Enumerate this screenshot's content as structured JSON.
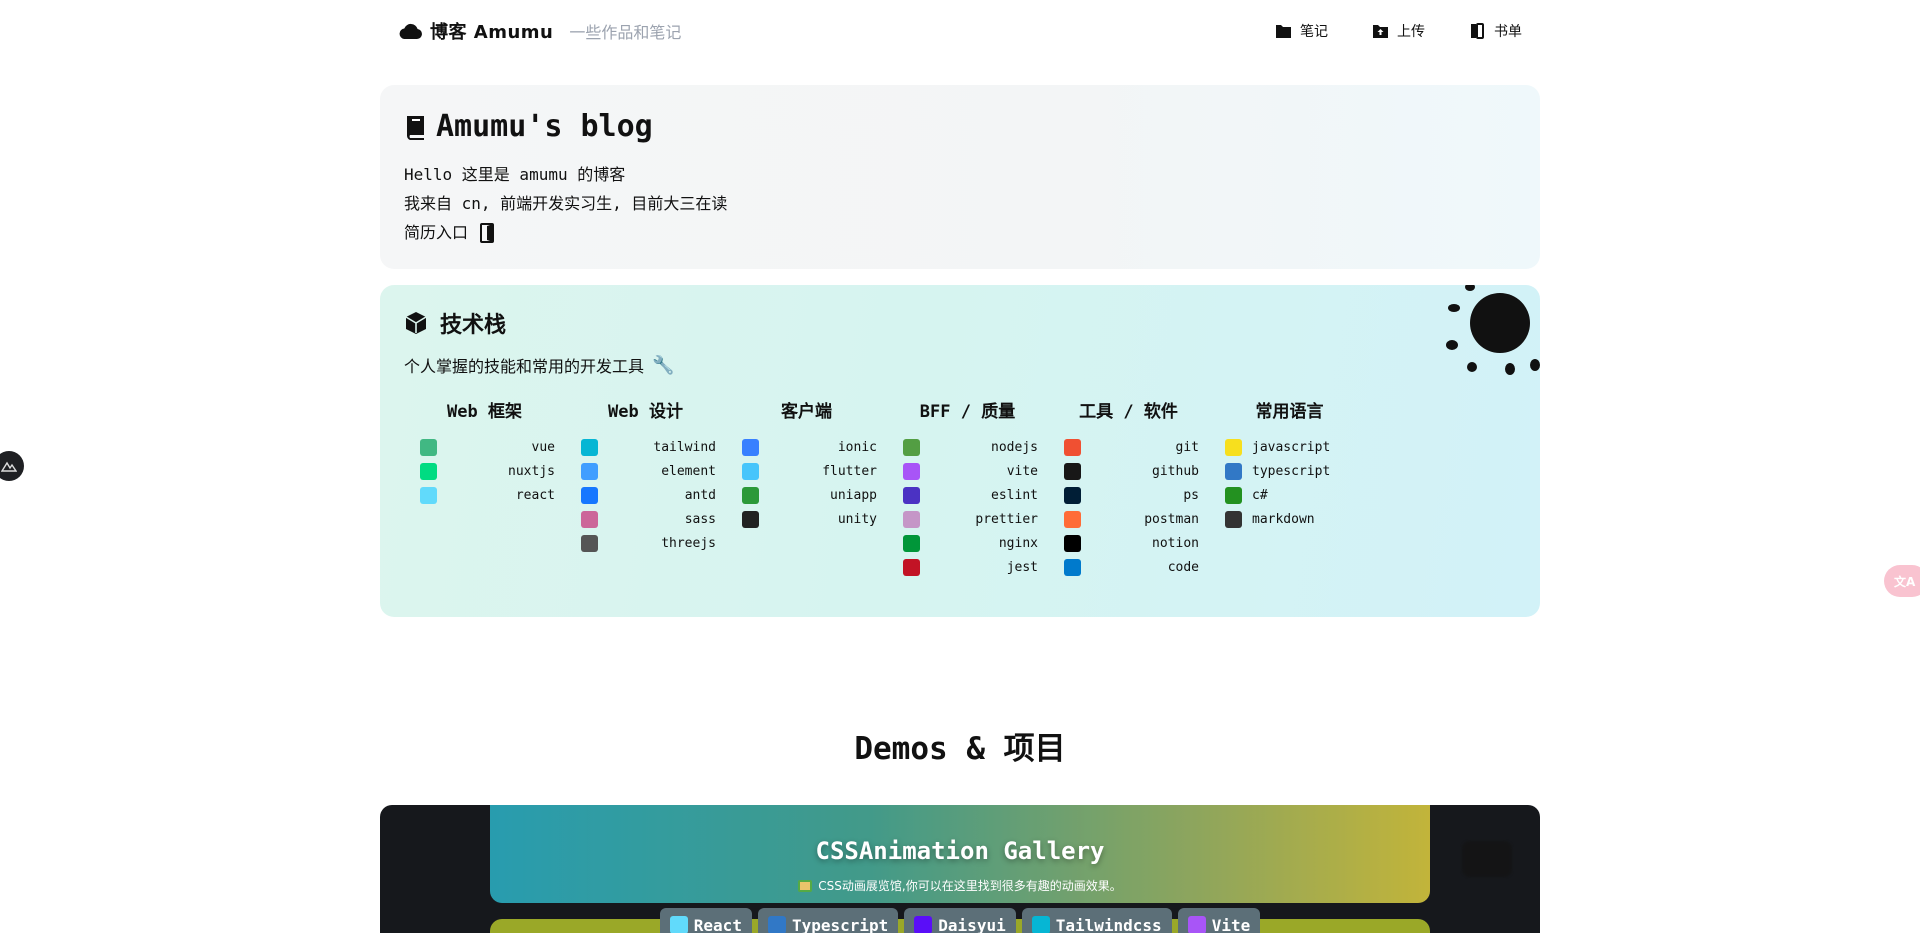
{
  "header": {
    "brand_title": "博客 Amumu",
    "brand_subtitle": "一些作品和笔记",
    "nav": [
      {
        "label": "笔记",
        "icon": "folder-icon"
      },
      {
        "label": "上传",
        "icon": "folder-upload-icon"
      },
      {
        "label": "书单",
        "icon": "books-icon"
      }
    ]
  },
  "blog": {
    "title": "Amumu's blog",
    "line1": "Hello 这里是 amumu 的博客",
    "line2": "我来自 cn, 前端开发实习生, 目前大三在读",
    "resume_label": "简历入口"
  },
  "tech": {
    "title": "技术栈",
    "subtitle": "个人掌握的技能和常用的开发工具",
    "columns": [
      {
        "heading": "Web 框架",
        "items": [
          {
            "label": "vue",
            "icon": "vue-icon",
            "color": "#41b883"
          },
          {
            "label": "nuxtjs",
            "icon": "nuxt-icon",
            "color": "#00dc82"
          },
          {
            "label": "react",
            "icon": "react-icon",
            "color": "#61dafb"
          }
        ]
      },
      {
        "heading": "Web 设计",
        "items": [
          {
            "label": "tailwind",
            "icon": "tailwind-icon",
            "color": "#06b6d4"
          },
          {
            "label": "element",
            "icon": "element-icon",
            "color": "#409eff"
          },
          {
            "label": "antd",
            "icon": "antd-icon",
            "color": "#1677ff"
          },
          {
            "label": "sass",
            "icon": "sass-icon",
            "color": "#cc6699"
          },
          {
            "label": "threejs",
            "icon": "threejs-icon",
            "color": "#555555"
          }
        ]
      },
      {
        "heading": "客户端",
        "items": [
          {
            "label": "ionic",
            "icon": "ionic-icon",
            "color": "#3880ff"
          },
          {
            "label": "flutter",
            "icon": "flutter-icon",
            "color": "#47c5fb"
          },
          {
            "label": "uniapp",
            "icon": "uniapp-icon",
            "color": "#2b9939"
          },
          {
            "label": "unity",
            "icon": "unity-icon",
            "color": "#222222"
          }
        ]
      },
      {
        "heading": "BFF / 质量",
        "items": [
          {
            "label": "nodejs",
            "icon": "nodejs-icon",
            "color": "#539e43"
          },
          {
            "label": "vite",
            "icon": "vite-icon",
            "color": "#a855f7"
          },
          {
            "label": "eslint",
            "icon": "eslint-icon",
            "color": "#4b32c3"
          },
          {
            "label": "prettier",
            "icon": "prettier-icon",
            "color": "#c596c7"
          },
          {
            "label": "nginx",
            "icon": "nginx-icon",
            "color": "#009639"
          },
          {
            "label": "jest",
            "icon": "jest-icon",
            "color": "#c21325"
          }
        ]
      },
      {
        "heading": "工具 / 软件",
        "items": [
          {
            "label": "git",
            "icon": "git-icon",
            "color": "#f05032"
          },
          {
            "label": "github",
            "icon": "github-icon",
            "color": "#181717"
          },
          {
            "label": "ps",
            "icon": "photoshop-icon",
            "color": "#001e36"
          },
          {
            "label": "postman",
            "icon": "postman-icon",
            "color": "#ff6c37"
          },
          {
            "label": "notion",
            "icon": "notion-icon",
            "color": "#000000"
          },
          {
            "label": "code",
            "icon": "vscode-icon",
            "color": "#007acc"
          }
        ]
      },
      {
        "heading": "常用语言",
        "items": [
          {
            "label": "javascript",
            "icon": "javascript-icon",
            "color": "#f7df1e"
          },
          {
            "label": "typescript",
            "icon": "typescript-icon",
            "color": "#3178c6"
          },
          {
            "label": "c#",
            "icon": "csharp-icon",
            "color": "#239120"
          },
          {
            "label": "markdown",
            "icon": "markdown-icon",
            "color": "#333333"
          }
        ]
      }
    ]
  },
  "demos": {
    "title": "Demos & 项目",
    "card_title": "CSSAnimation Gallery",
    "card_desc": "CSS动画展览馆,你可以在这里找到很多有趣的动画效果。",
    "tags": [
      {
        "label": "React",
        "icon": "react-icon"
      },
      {
        "label": "Typescript",
        "icon": "typescript-icon"
      },
      {
        "label": "Daisyui",
        "icon": "daisyui-icon"
      },
      {
        "label": "Tailwindcss",
        "icon": "tailwind-icon"
      },
      {
        "label": "Vite",
        "icon": "vite-icon"
      }
    ]
  },
  "widgets": {
    "translate_label": "文A"
  }
}
